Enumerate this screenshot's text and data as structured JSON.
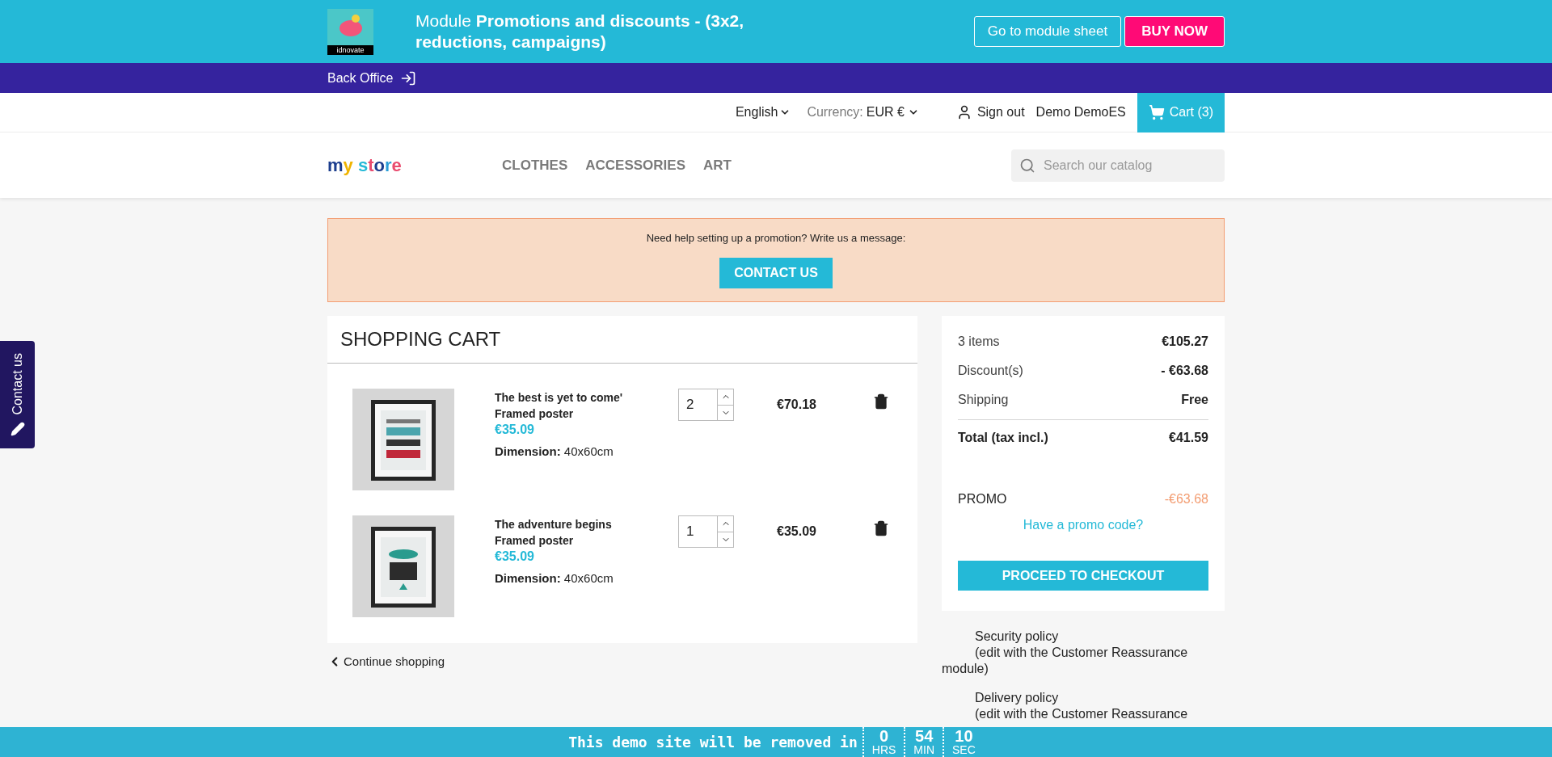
{
  "promo_banner": {
    "brand": "idnovate",
    "title": "Module **Promotions and discounts - (3x2, reductions, campaigns)**",
    "buttons": [
      {
        "label": "Go to module sheet",
        "kind": "outline"
      },
      {
        "label": "BUY NOW",
        "kind": "primary"
      }
    ]
  },
  "admin_bar": {
    "label": "Back Office"
  },
  "top_nav": {
    "language": "English",
    "currency_label": "Currency:",
    "currency": "EUR €",
    "sign_out": "Sign out",
    "customer": "Demo DemoES",
    "cart": "Cart (3)"
  },
  "header": {
    "logo": "my store",
    "menu": [
      "CLOTHES",
      "ACCESSORIES",
      "ART"
    ],
    "search": {
      "placeholder": "Search our catalog"
    }
  },
  "help_alert": {
    "message": "Need help setting up a promotion? Write us a message:",
    "button": "CONTACT US"
  },
  "cart": {
    "title": "SHOPPING CART",
    "items": [
      {
        "kind": "picture",
        "name": "The best is yet to come'",
        "subtitle": "Framed poster",
        "price": "€35.09",
        "attr_label": "Dimension:",
        "attr_value": "40x60cm",
        "quantity": "2",
        "total": "€70.18"
      },
      {
        "kind": "picture",
        "name": "The adventure begins",
        "subtitle": "Framed poster",
        "price": "€35.09",
        "attr_label": "Dimension:",
        "attr_value": "40x60cm",
        "quantity": "1",
        "total": "€35.09"
      }
    ],
    "continue": "Continue shopping"
  },
  "summary": {
    "lines": [
      {
        "label": "3 items",
        "value": "€105.27"
      },
      {
        "label": "Discount(s)",
        "value": "- €63.68"
      },
      {
        "label": "Shipping",
        "value": "Free"
      }
    ],
    "total": {
      "label": "Total (tax incl.)",
      "value": "€41.59"
    },
    "voucher": {
      "label": "PROMO",
      "value": "-€63.68"
    },
    "promo_link": "Have a promo code?",
    "checkout": "PROCEED TO CHECKOUT"
  },
  "reassurance": [
    {
      "title": "Security policy",
      "text": "(edit with the Customer Reassurance",
      "tail": "module)"
    },
    {
      "title": "Delivery policy",
      "text": "(edit with the Customer Reassurance"
    }
  ],
  "contact_tab": {
    "label": "Contact us"
  },
  "demo_bar": {
    "message": "This demo site will be removed in",
    "countdown": [
      {
        "value": "0",
        "unit": "HRS"
      },
      {
        "value": "54",
        "unit": "MIN"
      },
      {
        "value": "10",
        "unit": "SEC"
      }
    ]
  }
}
